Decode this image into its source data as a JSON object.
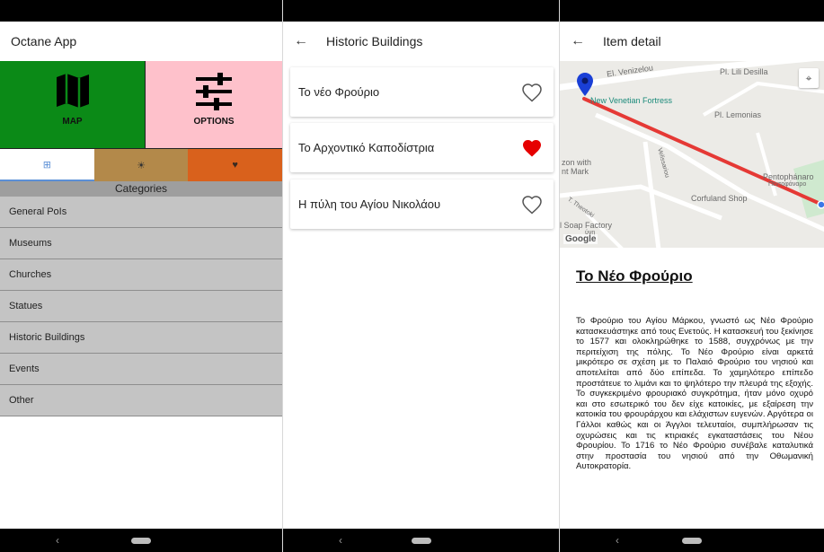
{
  "screen1": {
    "title": "Octane App",
    "tiles": {
      "map_label": "MAP",
      "options_label": "OPTIONS"
    },
    "tabs": [
      {
        "icon": "grid-icon",
        "glyph": "⊞"
      },
      {
        "icon": "sun-icon",
        "glyph": "☀"
      },
      {
        "icon": "heart-icon",
        "glyph": "♥"
      }
    ],
    "categories_header": "Categories",
    "categories": [
      "General PoIs",
      "Museums",
      "Churches",
      "Statues",
      "Historic Buildings",
      "Events",
      "Other"
    ],
    "colors": {
      "map_tile": "#0b8a17",
      "options_tile": "#fec1cb",
      "tab_sun": "#b3894a",
      "tab_heart": "#d9611c",
      "category_bg": "#c4c4c4"
    }
  },
  "screen2": {
    "back_glyph": "←",
    "title": "Historic Buildings",
    "items": [
      {
        "name": "Το νέο Φρούριο",
        "favorite": false
      },
      {
        "name": "Το Αρχοντικό Καποδίστρια",
        "favorite": true
      },
      {
        "name": "Η πύλη του Αγίου Νικολάου",
        "favorite": false
      }
    ],
    "colors": {
      "favorite": "#e60000"
    }
  },
  "screen3": {
    "back_glyph": "←",
    "title": "Item detail",
    "map": {
      "labels": {
        "street1": "El. Venizelou",
        "square1": "Pl. Lili Desilla",
        "fortress": "New Venetian Fortress",
        "square2": "Pl. Lemonias",
        "left_poi_line1": "zon with",
        "left_poi_line2": "nt Mark",
        "right_poi_line1": "Pentophánaro",
        "right_poi_line2": "Πεντοφάναρο",
        "street2": "Velissariou",
        "shop": "Corfuland Shop",
        "street3": "T. Theotoki",
        "factory_line1": "l Soap Factory",
        "factory_line2": "ύνη",
        "logo": "Google"
      },
      "locate_glyph": "⌖",
      "route_color": "#e53935"
    },
    "detail_title": "Το Νέο Φρούριο",
    "detail_text": "Το Φρούριο του Αγίου Μάρκου, γνωστό ως Νέο Φρούριο κατασκευάστηκε από τους Ενετούς. Η κατασκευή του ξεκίνησε το 1577 και ολοκληρώθηκε το 1588, συγχρόνως με την περιτείχιση της πόλης. Το Νέο Φρούριο είναι αρκετά μικρότερο σε σχέση με το Παλαιό Φρούριο του νησιού και αποτελείται από δύο επίπεδα. Το χαμηλότερο επίπεδο προστάτευε το λιμάνι και το ψηλότερο την πλευρά της εξοχής. Το συγκεκριμένο φρουριακό συγκρότημα, ήταν μόνο οχυρό και στο εσωτερικό του δεν είχε κατοικίες, με εξαίρεση την κατοικία του φρουράρχου και ελάχιστων ευγενών. Αργότερα οι Γάλλοι καθώς και οι Άγγλοι τελευταίοι, συμπλήρωσαν τις οχυρώσεις και τις κτιριακές εγκαταστάσεις του Νέου Φρουρίου. Το 1716 το Νέο Φρούριο συνέβαλε καταλυτικά στην προστασία του νησιού από την Οθωμανική Αυτοκρατορία."
  },
  "nav": {
    "back_glyph": "‹"
  }
}
